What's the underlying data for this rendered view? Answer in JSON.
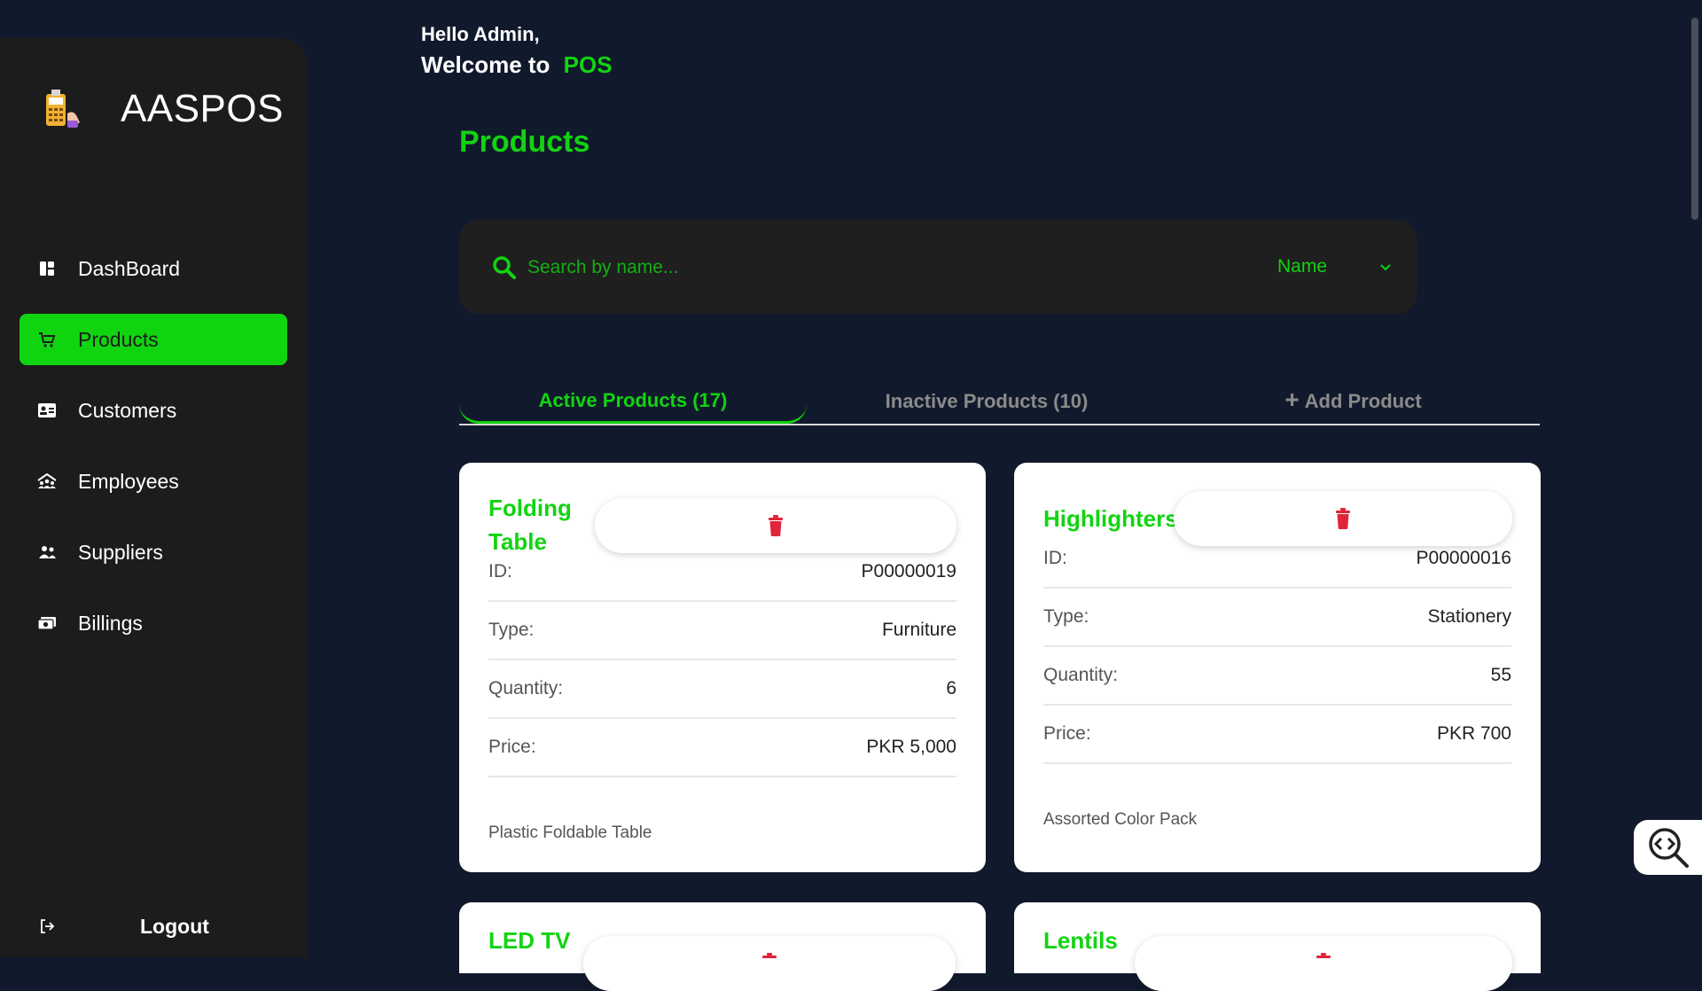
{
  "brand": {
    "name": "AASPOS"
  },
  "greeting": {
    "line1": "Hello Admin,",
    "line2_prefix": "Welcome to",
    "line2_accent": "POS"
  },
  "sidebar": {
    "items": [
      {
        "label": "DashBoard",
        "icon": "dashboard-icon"
      },
      {
        "label": "Products",
        "icon": "cart-icon",
        "active": true
      },
      {
        "label": "Customers",
        "icon": "id-card-icon"
      },
      {
        "label": "Employees",
        "icon": "employees-icon"
      },
      {
        "label": "Suppliers",
        "icon": "users-icon"
      },
      {
        "label": "Billings",
        "icon": "money-icon"
      }
    ],
    "logout_label": "Logout"
  },
  "page": {
    "title": "Products"
  },
  "search": {
    "placeholder": "Search by name...",
    "sort_value": "Name"
  },
  "tabs": {
    "active": "Active Products (17)",
    "inactive": "Inactive Products (10)",
    "add": "Add Product",
    "add_symbol": "+"
  },
  "labels": {
    "id": "ID:",
    "type": "Type:",
    "quantity": "Quantity:",
    "price": "Price:"
  },
  "products": [
    {
      "name": "Folding Table",
      "id": "P00000019",
      "type": "Furniture",
      "quantity": "6",
      "price": "PKR 5,000",
      "description": "Plastic Foldable Table"
    },
    {
      "name": "Highlighters",
      "id": "P00000016",
      "type": "Stationery",
      "quantity": "55",
      "price": "PKR 700",
      "description": "Assorted Color Pack"
    },
    {
      "name": "LED TV"
    },
    {
      "name": "Lentils"
    }
  ],
  "colors": {
    "accent": "#11d411",
    "background": "#111a2c",
    "sidebar": "#1c1c1c",
    "danger": "#e0243a"
  }
}
